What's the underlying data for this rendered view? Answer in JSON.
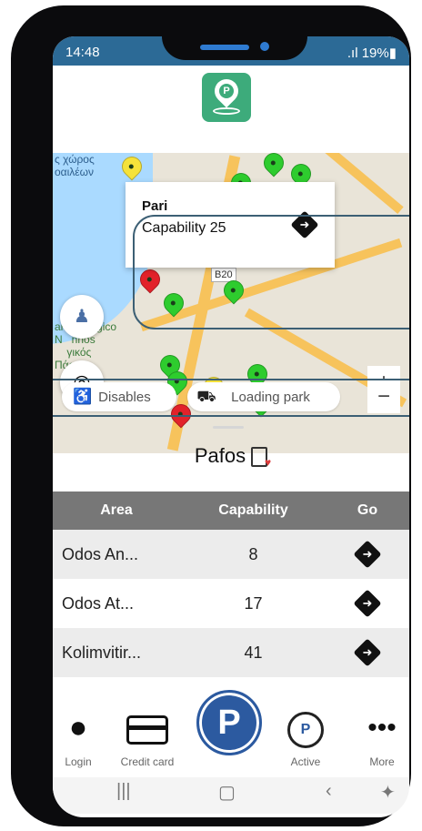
{
  "status": {
    "time": "14:48",
    "battery": ".ıl 19%▮"
  },
  "map": {
    "popup": {
      "name": "Pari",
      "capability": "Capability 25"
    },
    "labels": {
      "top_left": "ς χώρος\nοαιλέων",
      "mid_left": "archeologico\nN   nhos\n    γικός\nΠάφου",
      "road": "B20"
    },
    "zoom_in": "+",
    "zoom_out": "−"
  },
  "filters": [
    {
      "icon": "wheelchair-icon",
      "label": "Disables"
    },
    {
      "icon": "loading-icon",
      "label": "Loading park"
    }
  ],
  "city": {
    "name": "Pafos"
  },
  "table": {
    "headers": [
      "Area",
      "Capability",
      "Go"
    ],
    "rows": [
      {
        "area": "Odos An...",
        "capability": "8"
      },
      {
        "area": "Odos At...",
        "capability": "17"
      },
      {
        "area": "Kolimvitir...",
        "capability": "41"
      }
    ]
  },
  "nav": [
    {
      "icon": "user-icon",
      "label": "Login"
    },
    {
      "icon": "credit-card-icon",
      "label": "Credit card"
    },
    {
      "icon": "parking-icon",
      "label": "P"
    },
    {
      "icon": "timer-icon",
      "label": "Active"
    },
    {
      "icon": "more-icon",
      "label": "More"
    }
  ],
  "colors": {
    "status_bar": "#2c6a96",
    "logo": "#3dab7b",
    "header": "#777777",
    "parking": "#2c5aa0"
  }
}
